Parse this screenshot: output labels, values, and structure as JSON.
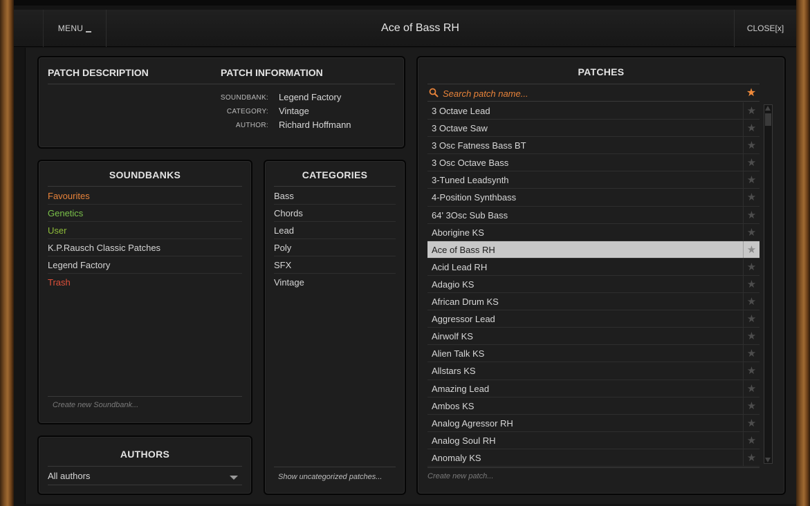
{
  "titlebar": {
    "menu_label": "MENU",
    "title": "Ace of Bass RH",
    "close_label": "CLOSE[x]"
  },
  "patch_description": {
    "heading": "PATCH DESCRIPTION",
    "info_heading": "PATCH INFORMATION",
    "soundbank_key": "SOUNDBANK:",
    "soundbank_value": "Legend Factory",
    "category_key": "CATEGORY:",
    "category_value": "Vintage",
    "author_key": "AUTHOR:",
    "author_value": "Richard Hoffmann"
  },
  "soundbanks": {
    "heading": "SOUNDBANKS",
    "items": [
      {
        "label": "Favourites",
        "color": "#e8833a"
      },
      {
        "label": "Genetics",
        "color": "#7ac04a"
      },
      {
        "label": "User",
        "color": "#8fbd3a"
      },
      {
        "label": "K.P.Rausch Classic Patches",
        "color": "#d8d8d8"
      },
      {
        "label": "Legend Factory",
        "color": "#d8d8d8"
      },
      {
        "label": "Trash",
        "color": "#e0503a"
      }
    ],
    "create_placeholder": "Create new Soundbank..."
  },
  "categories": {
    "heading": "CATEGORIES",
    "items": [
      "Bass",
      "Chords",
      "Lead",
      "Poly",
      "SFX",
      "Vintage"
    ],
    "show_uncategorized": "Show uncategorized patches..."
  },
  "authors": {
    "heading": "AUTHORS",
    "selected": "All authors"
  },
  "patches": {
    "heading": "PATCHES",
    "search_placeholder": "Search patch name...",
    "create_placeholder": "Create new patch...",
    "selected_index": 8,
    "items": [
      "3 Octave Lead",
      "3 Octave Saw",
      "3 Osc Fatness Bass BT",
      "3 Osc Octave Bass",
      "3-Tuned Leadsynth",
      "4-Position Synthbass",
      "64' 3Osc Sub Bass",
      "Aborigine KS",
      "Ace of Bass RH",
      "Acid Lead RH",
      "Adagio KS",
      "African Drum KS",
      "Aggressor Lead",
      "Airwolf KS",
      "Alien Talk KS",
      "Allstars KS",
      "Amazing Lead",
      "Ambos KS",
      "Analog Agressor RH",
      "Analog Soul RH",
      "Anomaly KS"
    ]
  },
  "colors": {
    "accent": "#e8833a",
    "selected_row": "#c8c8c8",
    "panel_bg": "#1e1e1e"
  }
}
